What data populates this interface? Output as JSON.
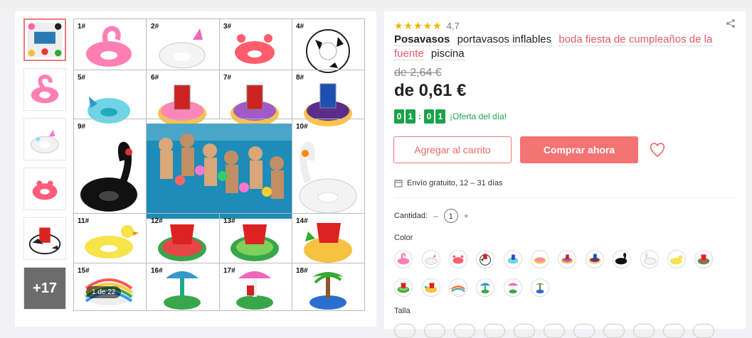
{
  "breadcrumb_text": "",
  "gallery": {
    "more_label": "+17",
    "counter": "1 de 22",
    "grid_labels": [
      "1#",
      "2#",
      "3#",
      "4#",
      "5#",
      "6#",
      "7#",
      "8#",
      "9#",
      "10#",
      "11#",
      "12#",
      "13#",
      "14#",
      "15#",
      "16#",
      "17#",
      "18#"
    ]
  },
  "product": {
    "rating": "4,7",
    "title_parts": [
      "Posavasos",
      "portavasos inflables",
      "boda fiesta de cumpleaños de la fuente",
      "piscina"
    ],
    "old_price": "de 2,64 €",
    "price": "de 0,61 €",
    "timer_digits": [
      "0",
      "1",
      "0",
      "1"
    ],
    "deal_label": "¡Oferta del día!",
    "add_to_cart": "Agregar al carrito",
    "buy_now": "Comprar ahora",
    "shipping": "Envío gratuito, 12 – 31 días",
    "quantity_label": "Cantidad:",
    "quantity_value": "1",
    "color_label": "Color",
    "size_label": "Talla"
  },
  "colors": {
    "accent": "#f47373",
    "green": "#1aa34a",
    "star": "#f0b400"
  }
}
